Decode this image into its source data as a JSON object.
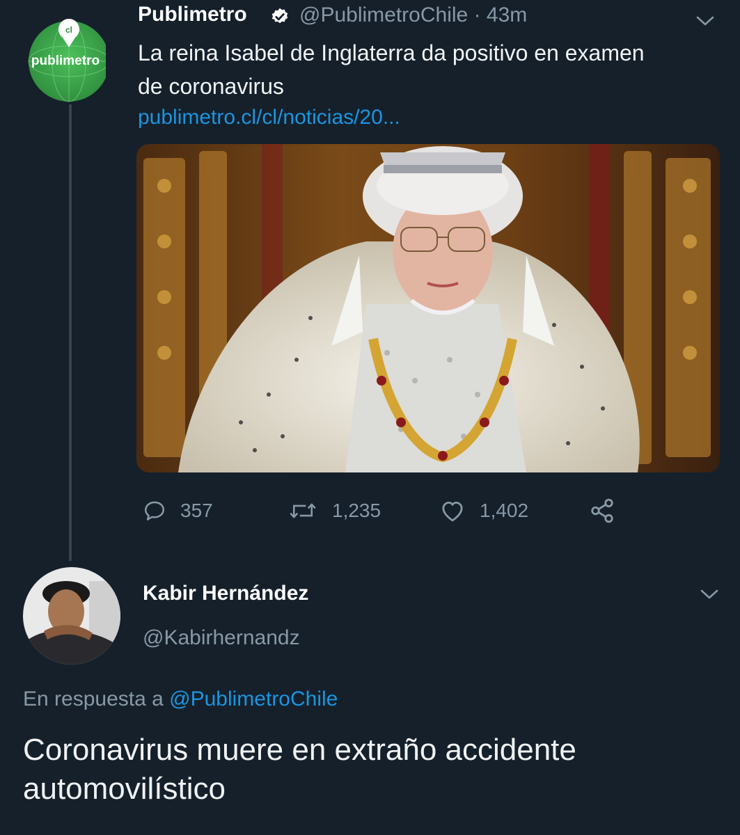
{
  "original_tweet": {
    "author_name": "Publimetro",
    "author_handle": "@PublimetroChile",
    "time_ago": "43m",
    "avatar_logo_text": "publimetro",
    "text_line1": "La reina Isabel de Inglaterra da positivo en examen",
    "text_line2": "de coronavirus",
    "link": "publimetro.cl/cl/noticias/20...",
    "media_icon": "photo-queen-elizabeth",
    "stats": {
      "replies": "357",
      "retweets": "1,235",
      "likes": "1,402"
    },
    "icons": {
      "reply": "speech-bubble-icon",
      "retweet": "retweet-arrows-icon",
      "like": "heart-icon",
      "share": "share-nodes-icon",
      "verified": "verified-badge-icon",
      "menu": "chevron-down-icon"
    }
  },
  "reply_tweet": {
    "author_name": "Kabir Hernández",
    "author_handle": "@Kabirhernandz",
    "reply_prefix": "En respuesta a",
    "reply_mention": "@PublimetroChile",
    "text": "Coronavirus muere en extraño accidente automovilístico"
  },
  "colors": {
    "background": "#15202b",
    "secondary_text": "#8899a6",
    "link": "#1b95e0",
    "verified_badge": "#ffffff",
    "publimetro_green": "#3aa84a"
  }
}
